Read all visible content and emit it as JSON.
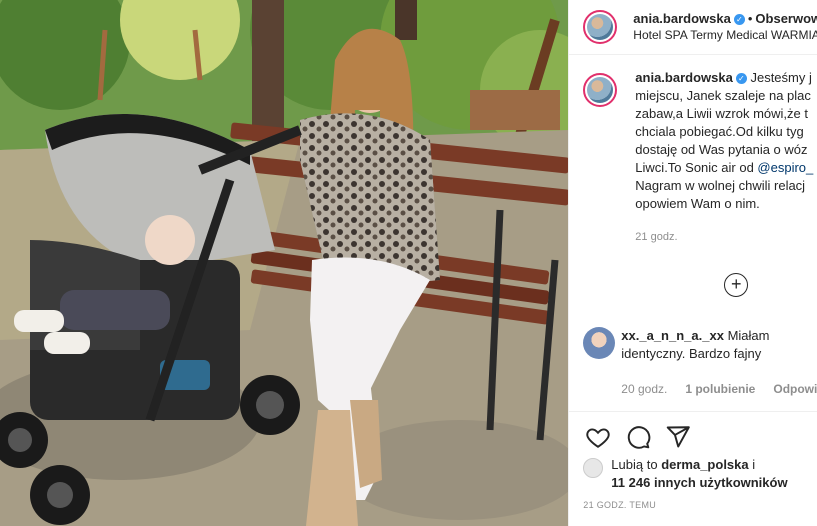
{
  "post": {
    "username": "ania.bardowska",
    "follow_label": "Obserwow",
    "location": "Hotel SPA Termy Medical WARMIA",
    "caption_lines": [
      "Jesteśmy j",
      "miejscu, Janek szaleje na plac",
      "zabaw,a Liwii wzrok mówi,że t",
      "chciala pobiegać.Od kilku tyg",
      "dostaję od Was pytania o wóz",
      "Liwci.To Sonic air od ",
      "Nagram w wolnej chwili relacj",
      "opowiem Wam o nim."
    ],
    "caption_mention": "@espiro_",
    "time": "21 godz."
  },
  "comment": {
    "username": "xx._a_n_n_a._xx",
    "text_1": "Miałam",
    "text_2": "identyczny. Bardzo fajny",
    "time": "20 godz.",
    "likes": "1 polubienie",
    "reply": "Odpowi"
  },
  "likes": {
    "prefix": "Lubią to",
    "liker": "derma_polska",
    "suffix": "i",
    "count_text": "11 246 innych użytkowników"
  },
  "date": "21 GODZ. TEMU",
  "icons": {
    "verified": "verified-badge-icon",
    "add": "plus-circle-icon",
    "like": "heart-icon",
    "comment": "comment-icon",
    "share": "paper-plane-icon"
  },
  "colors": {
    "link": "#00376b",
    "secondary": "#8e8e8e",
    "verified": "#3897f0",
    "story_ring": "#e1306c"
  }
}
